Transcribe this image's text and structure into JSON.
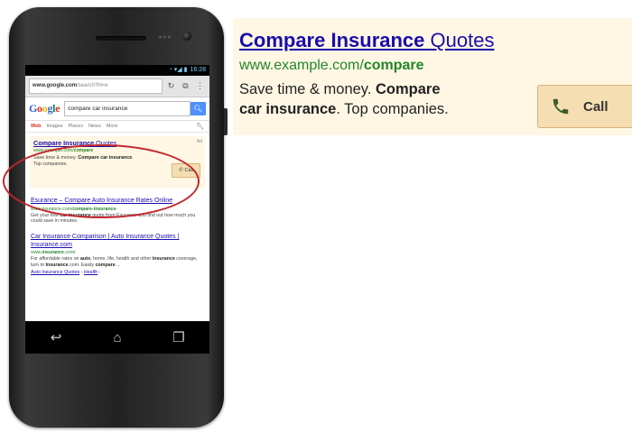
{
  "phone": {
    "status_time": "16:28",
    "browser": {
      "url_domain": "www.google.com",
      "url_path": "/search?hl=e",
      "reload_icon": "reload-icon",
      "tabs_icon": "tabs-icon",
      "menu_icon": "overflow-menu-icon"
    },
    "search": {
      "logo": [
        "G",
        "o",
        "o",
        "g",
        "l",
        "e"
      ],
      "query": "compare car insurance",
      "button_icon": "search-icon"
    },
    "tabs": [
      "Web",
      "Images",
      "Places",
      "News",
      "More"
    ],
    "ad": {
      "title_bold": "Compare Insurance",
      "title_rest": " Quotes",
      "url_prefix": "www.example.com/",
      "url_bold": "compare",
      "desc_1": "Save time & money. ",
      "desc_2_bold": "Compare",
      "desc_3_bold": "car insurance",
      "desc_4": ". Top companies.",
      "ad_label": "Ad",
      "call_label": "Call"
    },
    "results": [
      {
        "title": "Esurance – Compare Auto Insurance Rates Online",
        "url_prefix": "www.esurance.com/",
        "url_bold": "compare-insurance-",
        "desc_1": "Get your free ",
        "desc_2_bold": "car insurance",
        "desc_3": " quote from Esurance and find out how much you could save in minutes."
      },
      {
        "title": "Car Insurance Comparison | Auto Insurance Quotes | Insurance.com",
        "url_prefix": "www.",
        "url_bold": "insurance",
        "url_suffix": ".com/",
        "desc_1": "For affordable rates on ",
        "desc_2_bold": "auto",
        "desc_3": ", home, life, health and other ",
        "desc_4_bold": "insurance",
        "desc_5": " coverage, turn to ",
        "desc_6_bold": "Insurance",
        "desc_7": ".com. Easily ",
        "desc_8_bold": "compare",
        "desc_9": " ...",
        "link_1": "Auto Insurance Quotes",
        "link_sep": " - ",
        "link_2": "Health",
        "link_tail": " -"
      }
    ],
    "nav": [
      "back-icon",
      "home-icon",
      "recent-apps-icon"
    ]
  },
  "big_ad": {
    "title_bold": "Compare Insurance",
    "title_rest": " Quotes",
    "url_prefix": "www.example.com/",
    "url_bold": "compare",
    "desc_1": "Save time & money. ",
    "desc_2_bold": "Compare",
    "desc_3_bold": "car insurance",
    "desc_4": ". Top companies.",
    "call_label": "Call",
    "call_icon": "phone-icon"
  },
  "colors": {
    "link": "#1a0dab",
    "url_green": "#22852a",
    "ad_bg": "#fff7e4",
    "call_bg": "#f6deb3",
    "highlight_ring": "#c2272d"
  }
}
